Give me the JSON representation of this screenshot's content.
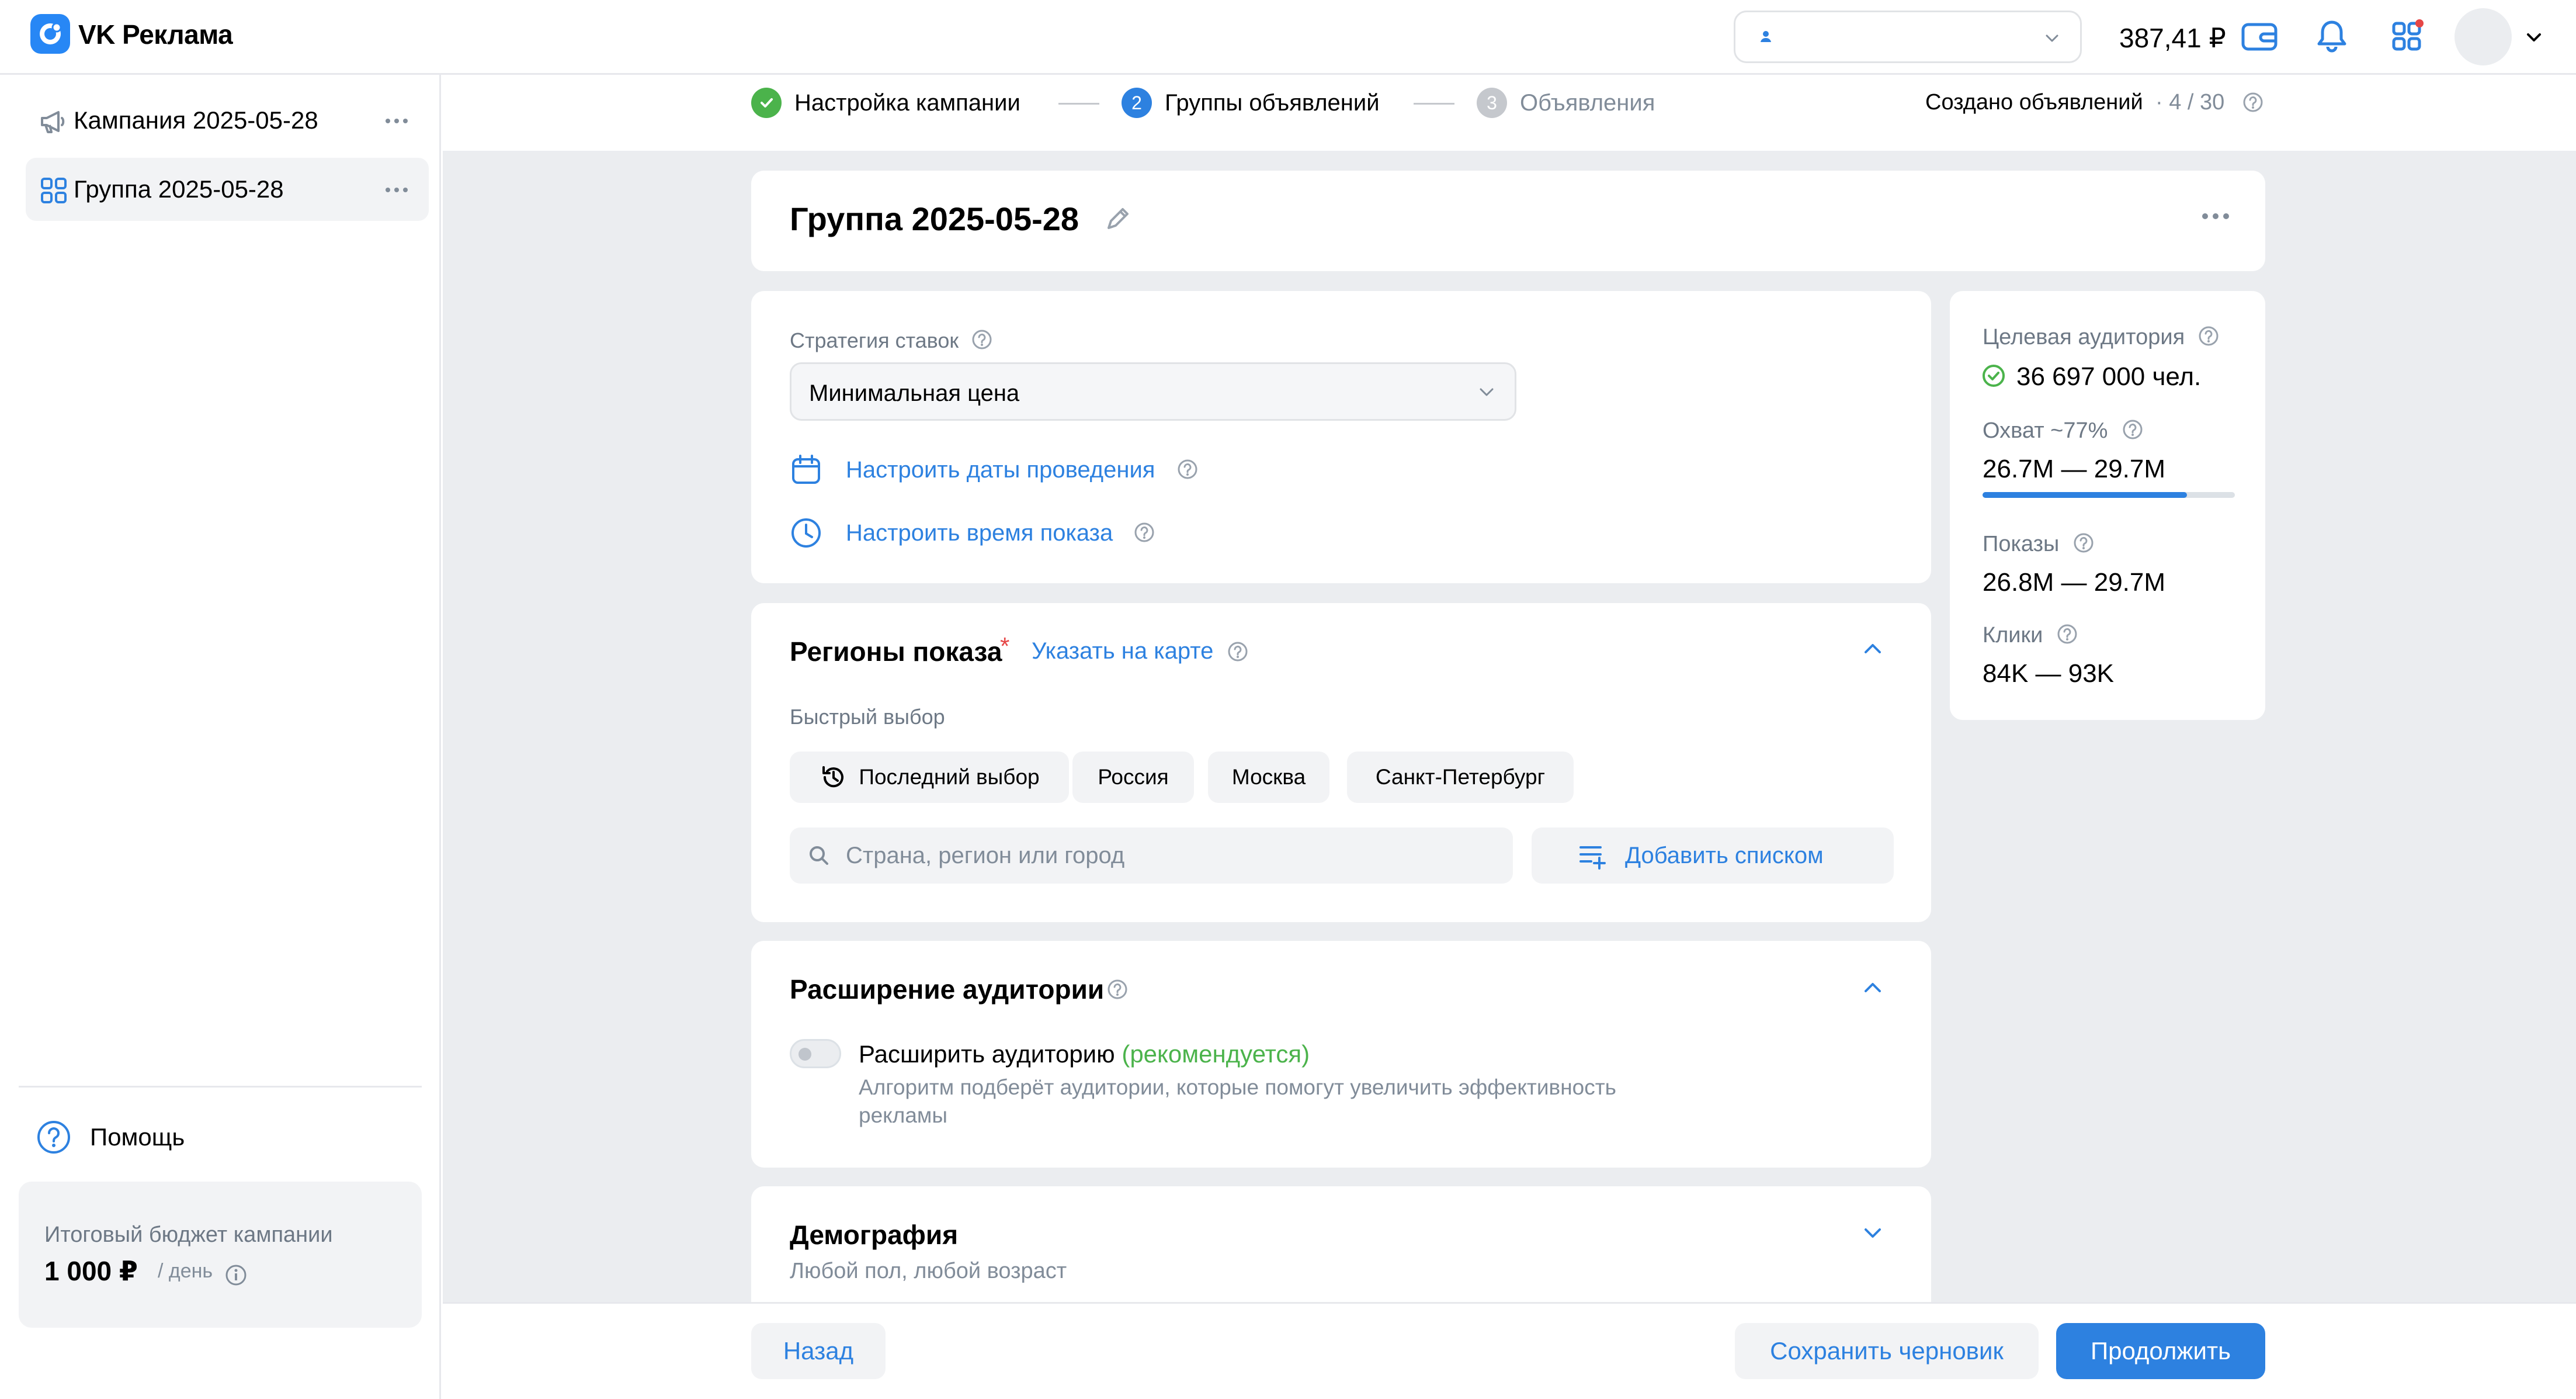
{
  "app": {
    "title": "VK Реклама"
  },
  "topbar": {
    "balance": "387,41 ₽"
  },
  "sidebar": {
    "items": [
      {
        "label": "Кампания 2025-05-28"
      },
      {
        "label": "Группа 2025-05-28"
      }
    ],
    "help_label": "Помощь",
    "budget": {
      "title": "Итоговый бюджет кампании",
      "value": "1 000 ₽",
      "unit": "/ день"
    }
  },
  "stepper": {
    "steps": [
      {
        "number": "",
        "label": "Настройка кампании",
        "status": "done"
      },
      {
        "number": "2",
        "label": "Группы объявлений",
        "status": "active"
      },
      {
        "number": "3",
        "label": "Объявления",
        "status": "pending"
      }
    ],
    "created_label": "Создано объявлений",
    "created_count": "· 4 / 30"
  },
  "group": {
    "title": "Группа 2025-05-28"
  },
  "strategy": {
    "label": "Стратегия ставок",
    "value": "Минимальная цена",
    "dates_link": "Настроить даты проведения",
    "time_link": "Настроить время показа"
  },
  "regions": {
    "title": "Регионы показа",
    "required_mark": "*",
    "map_link": "Указать на карте",
    "quick_label": "Быстрый выбор",
    "chips": [
      "Последний выбор",
      "Россия",
      "Москва",
      "Санкт-Петербург"
    ],
    "search_placeholder": "Страна, регион или город",
    "add_list_label": "Добавить списком"
  },
  "expansion": {
    "title": "Расширение аудитории",
    "toggle_label": "Расширить аудиторию",
    "recommended": "(рекомендуется)",
    "description_line1": "Алгоритм подберёт аудитории, которые помогут увеличить эффективность",
    "description_line2": "рекламы",
    "toggle_on": false
  },
  "demography": {
    "title": "Демография",
    "subtitle": "Любой пол, любой возраст"
  },
  "stats": {
    "audience_label": "Целевая аудитория",
    "audience_value": "36 697 000 чел.",
    "reach_label": "Охват ~77%",
    "reach_value": "26.7M — 29.7M",
    "reach_progress": 0.81,
    "impressions_label": "Показы",
    "impressions_value": "26.8M — 29.7M",
    "clicks_label": "Клики",
    "clicks_value": "84K — 93K"
  },
  "footer": {
    "back": "Назад",
    "save_draft": "Сохранить черновик",
    "continue": "Продолжить"
  },
  "colors": {
    "accent": "#2d81e0",
    "success": "#4bb34b",
    "background": "#ebedf0",
    "danger": "#e64646"
  }
}
